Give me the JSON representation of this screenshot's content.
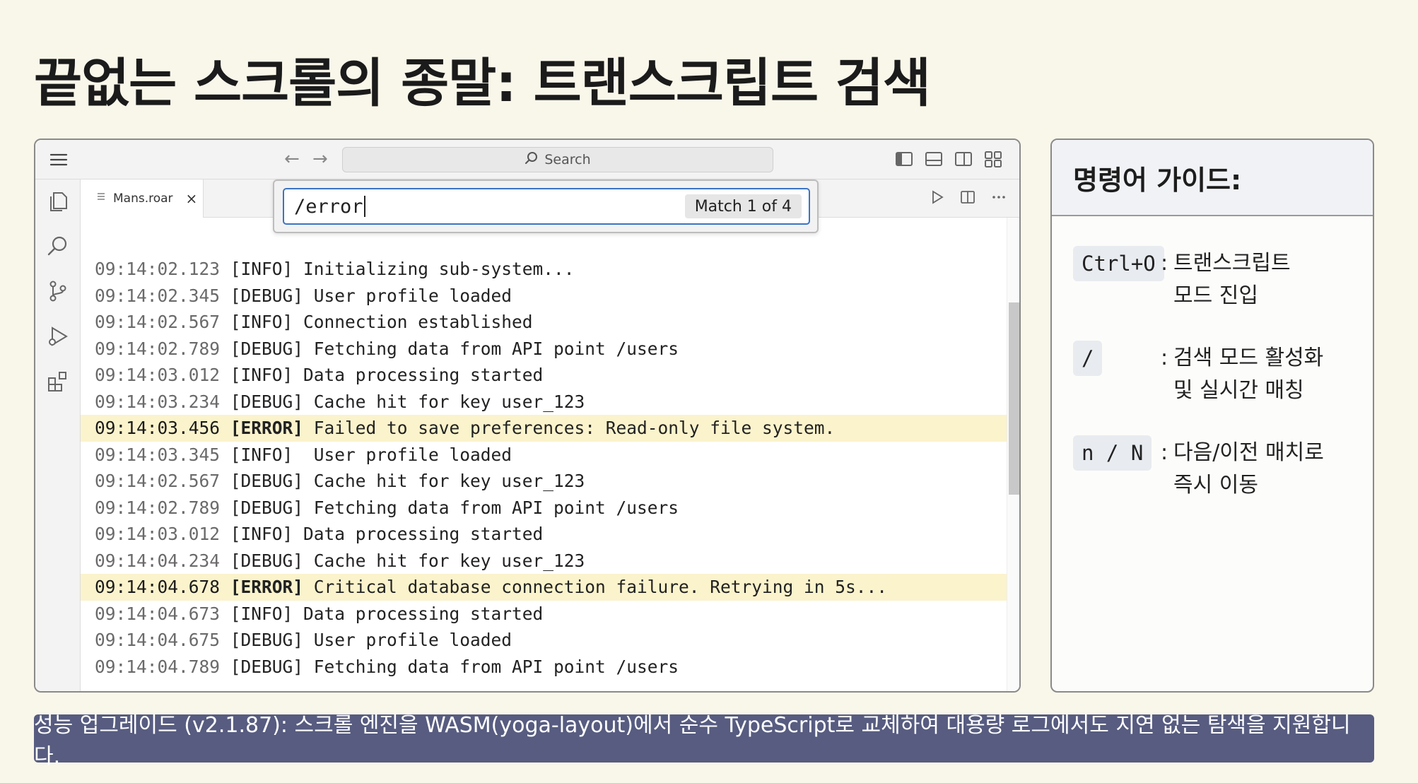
{
  "page": {
    "title": "끝없는 스크롤의 종말: 트랜스크립트 검색"
  },
  "editor": {
    "search_placeholder": "Search",
    "tab": {
      "label": "Mans.roar",
      "close": "×"
    },
    "find": {
      "query": "/error",
      "match_label": "Match 1 of 4"
    },
    "log_lines": [
      {
        "ts": "09:14:02.123",
        "level": "[INFO]",
        "msg": " Initializing sub-system...",
        "highlight": false
      },
      {
        "ts": "09:14:02.345",
        "level": "[DEBUG]",
        "msg": " User profile loaded",
        "highlight": false
      },
      {
        "ts": "09:14:02.567",
        "level": "[INFO]",
        "msg": " Connection established",
        "highlight": false
      },
      {
        "ts": "09:14:02.789",
        "level": "[DEBUG]",
        "msg": " Fetching data from API point /users",
        "highlight": false
      },
      {
        "ts": "09:14:03.012",
        "level": "[INFO]",
        "msg": " Data processing started",
        "highlight": false
      },
      {
        "ts": "09:14:03.234",
        "level": "[DEBUG]",
        "msg": " Cache hit for key user_123",
        "highlight": false
      },
      {
        "ts": "09:14:03.456",
        "level": "[ERROR]",
        "msg": " Failed to save preferences: Read-only file system.",
        "highlight": true
      },
      {
        "ts": "09:14:03.345",
        "level": "[INFO]",
        "msg": "  User profile loaded",
        "highlight": false
      },
      {
        "ts": "09:14:02.567",
        "level": "[DEBUG]",
        "msg": " Cache hit for key user_123",
        "highlight": false
      },
      {
        "ts": "09:14:02.789",
        "level": "[DEBUG]",
        "msg": " Fetching data from API point /users",
        "highlight": false
      },
      {
        "ts": "09:14:03.012",
        "level": "[INFO]",
        "msg": " Data processing started",
        "highlight": false
      },
      {
        "ts": "09:14:04.234",
        "level": "[DEBUG]",
        "msg": " Cache hit for key user_123",
        "highlight": false
      },
      {
        "ts": "09:14:04.678",
        "level": "[ERROR]",
        "msg": " Critical database connection failure. Retrying in 5s...",
        "highlight": true
      },
      {
        "ts": "09:14:04.673",
        "level": "[INFO]",
        "msg": " Data processing started",
        "highlight": false
      },
      {
        "ts": "09:14:04.675",
        "level": "[DEBUG]",
        "msg": " User profile loaded",
        "highlight": false
      },
      {
        "ts": "09:14:04.789",
        "level": "[DEBUG]",
        "msg": " Fetching data from API point /users",
        "highlight": false
      }
    ]
  },
  "guide": {
    "title": "명령어 가이드:",
    "items": [
      {
        "key": "Ctrl+O",
        "line1": "트랜스크립트",
        "line2": "모드 진입"
      },
      {
        "key": "/",
        "line1": "검색 모드 활성화",
        "line2": "및 실시간 매칭"
      },
      {
        "key": "n / N",
        "line1": "다음/이전 매치로",
        "line2": "즉시 이동"
      }
    ]
  },
  "footer": {
    "text": "성능 업그레이드 (v2.1.87): 스크롤 엔진을 WASM(yoga-layout)에서 순수 TypeScript로 교체하여 대용량 로그에서도 지연 없는 탐색을 지원합니다."
  },
  "colors": {
    "background": "#f9f6ea",
    "highlight": "#fbf3cc",
    "banner": "#575c80",
    "find_border": "#3a74c5"
  }
}
